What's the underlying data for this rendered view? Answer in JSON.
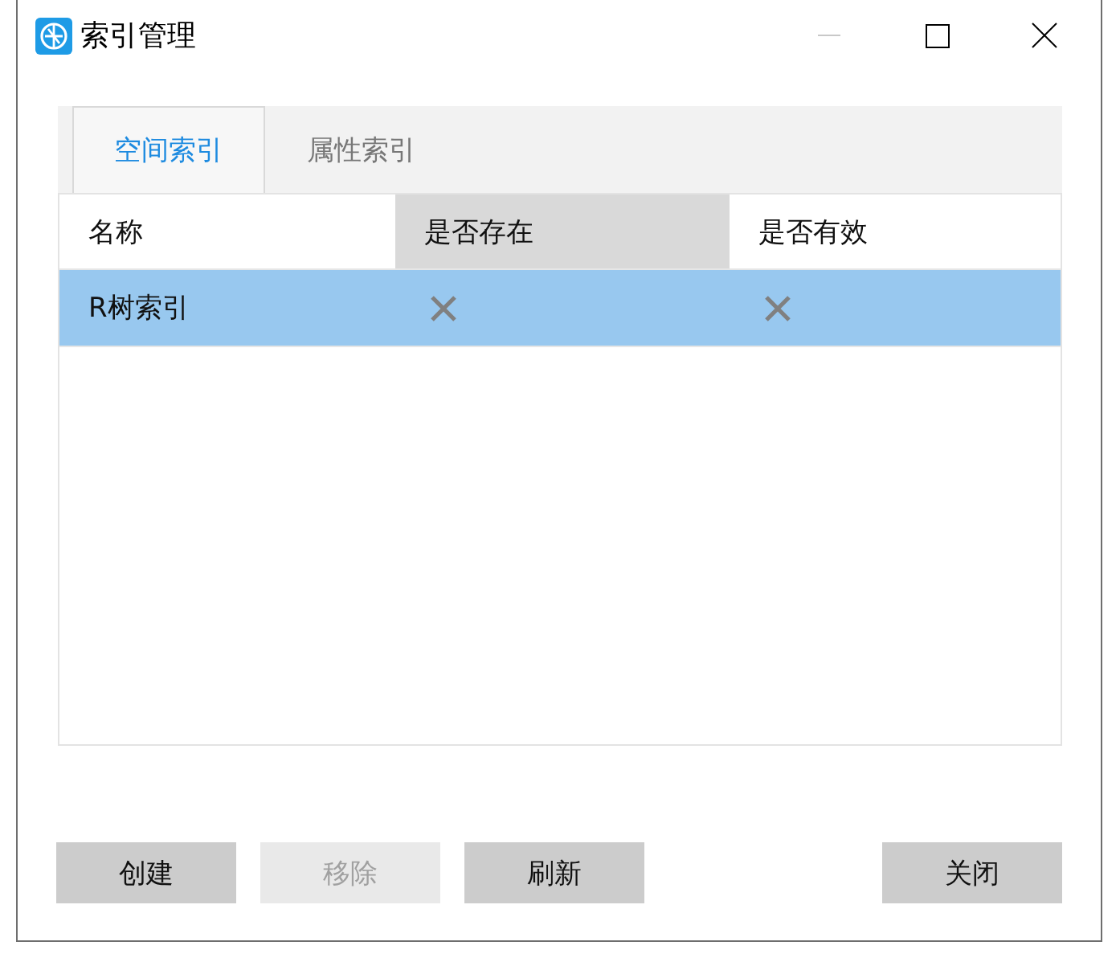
{
  "window": {
    "title": "索引管理",
    "minimize_disabled": true
  },
  "tabs": [
    {
      "label": "空间索引",
      "selected": true
    },
    {
      "label": "属性索引",
      "selected": false
    }
  ],
  "table": {
    "columns": [
      {
        "label": "名称",
        "highlighted": false
      },
      {
        "label": "是否存在",
        "highlighted": true
      },
      {
        "label": "是否有效",
        "highlighted": false
      }
    ],
    "rows": [
      {
        "name": "R树索引",
        "exists": false,
        "valid": false,
        "selected": true
      }
    ]
  },
  "buttons": [
    {
      "label": "创建",
      "kind": "action",
      "disabled": false
    },
    {
      "label": "移除",
      "kind": "action",
      "disabled": true
    },
    {
      "label": "刷新",
      "kind": "action",
      "disabled": false
    },
    {
      "label": "关闭",
      "kind": "dismiss",
      "disabled": false
    }
  ]
}
